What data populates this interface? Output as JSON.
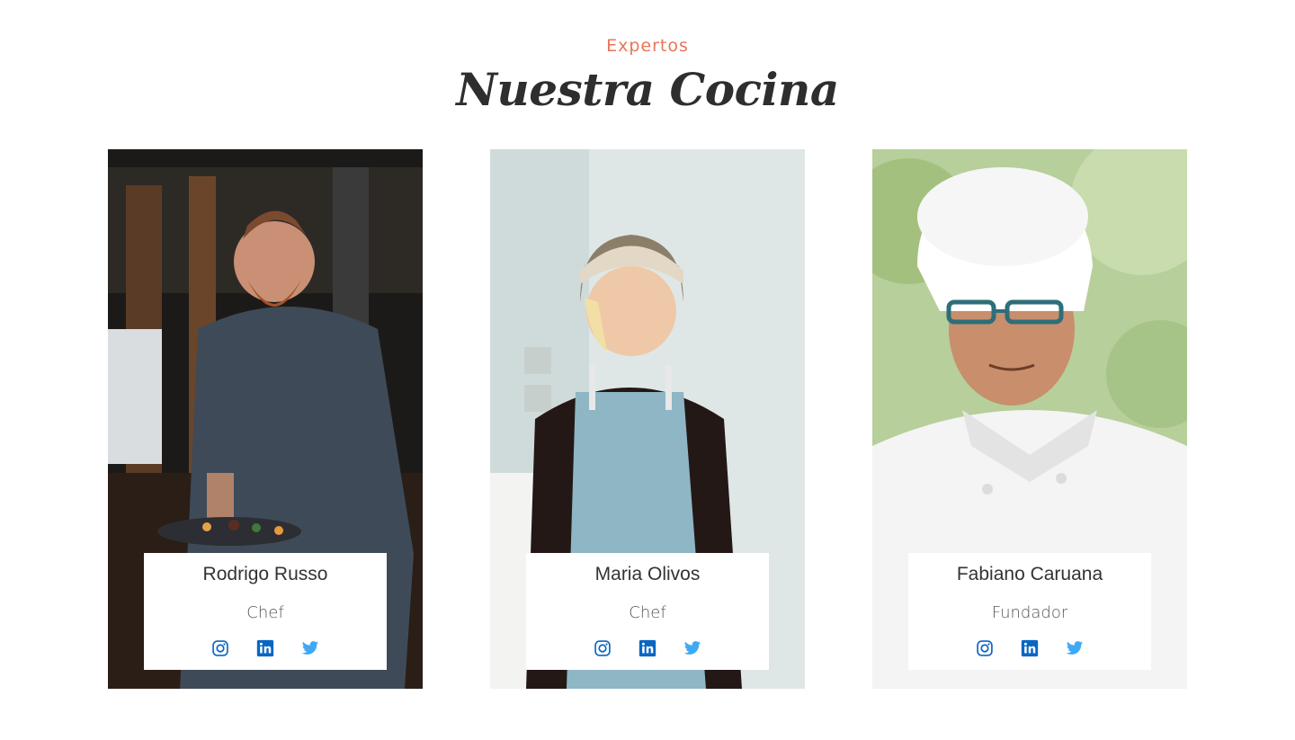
{
  "header": {
    "eyebrow": "Expertos",
    "title": "Nuestra Cocina"
  },
  "colors": {
    "accent": "#e8765a",
    "instagram": "#0a66c2",
    "linkedin": "#0a66c2",
    "twitter": "#3fa9f5"
  },
  "team": [
    {
      "name": "Rodrigo Russo",
      "role": "Chef",
      "socials": [
        "instagram-icon",
        "linkedin-icon",
        "twitter-icon"
      ]
    },
    {
      "name": "Maria Olivos",
      "role": "Chef",
      "socials": [
        "instagram-icon",
        "linkedin-icon",
        "twitter-icon"
      ]
    },
    {
      "name": "Fabiano Caruana",
      "role": "Fundador",
      "socials": [
        "instagram-icon",
        "linkedin-icon",
        "twitter-icon"
      ]
    }
  ]
}
